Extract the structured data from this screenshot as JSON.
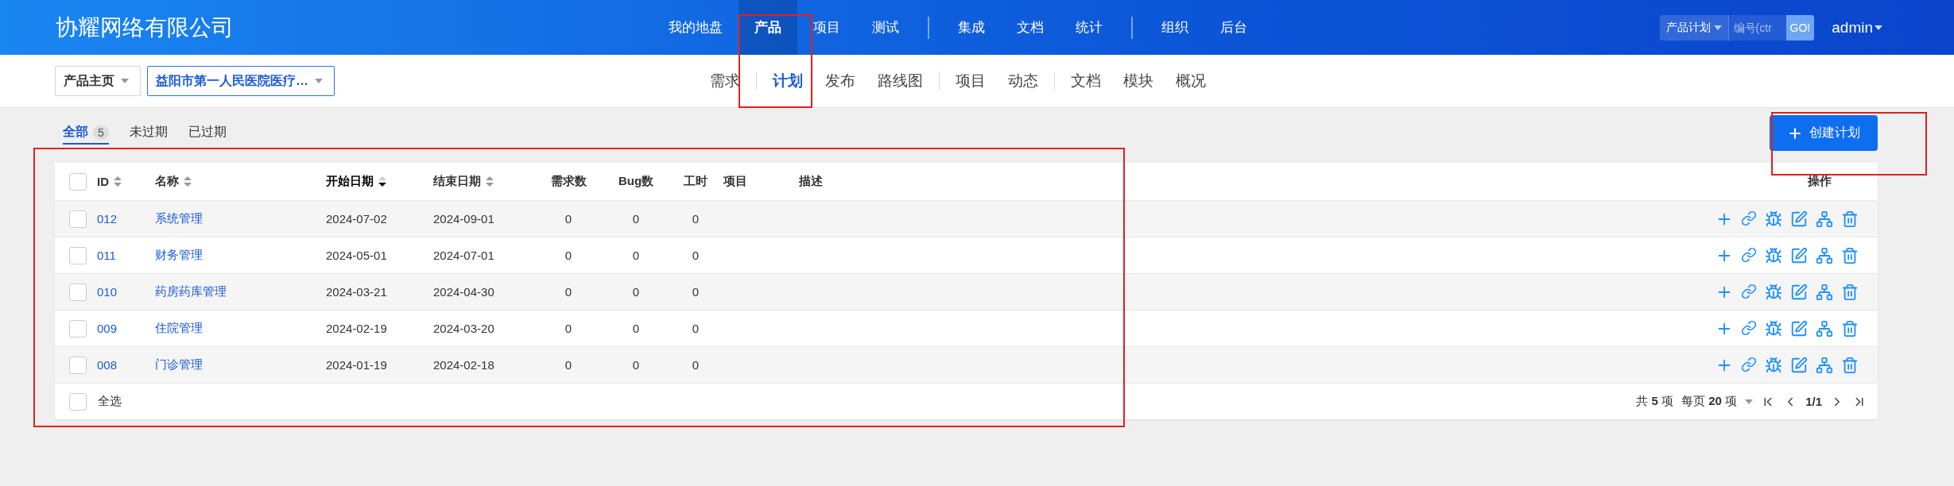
{
  "header": {
    "company": "协耀网络有限公司",
    "nav": [
      {
        "kind": "link",
        "label": "我的地盘",
        "selected": false
      },
      {
        "kind": "link",
        "label": "产品",
        "selected": true
      },
      {
        "kind": "link",
        "label": "项目",
        "selected": false
      },
      {
        "kind": "link",
        "label": "测试",
        "selected": false
      },
      {
        "kind": "divider"
      },
      {
        "kind": "link",
        "label": "集成",
        "selected": false
      },
      {
        "kind": "link",
        "label": "文档",
        "selected": false
      },
      {
        "kind": "link",
        "label": "统计",
        "selected": false
      },
      {
        "kind": "divider"
      },
      {
        "kind": "link",
        "label": "组织",
        "selected": false
      },
      {
        "kind": "link",
        "label": "后台",
        "selected": false
      }
    ],
    "search": {
      "scope": "产品计划",
      "placeholder": "编号(ctr",
      "button": "GO!"
    },
    "user": "admin"
  },
  "subbar": {
    "breadcrumbs": [
      {
        "label": "产品主页",
        "selected": false
      },
      {
        "label": "益阳市第一人民医院医疗…",
        "selected": true
      }
    ],
    "tabs": [
      {
        "kind": "link",
        "label": "需求",
        "selected": false
      },
      {
        "kind": "divider"
      },
      {
        "kind": "link",
        "label": "计划",
        "selected": true
      },
      {
        "kind": "link",
        "label": "发布",
        "selected": false
      },
      {
        "kind": "link",
        "label": "路线图",
        "selected": false
      },
      {
        "kind": "divider"
      },
      {
        "kind": "link",
        "label": "项目",
        "selected": false
      },
      {
        "kind": "link",
        "label": "动态",
        "selected": false
      },
      {
        "kind": "divider"
      },
      {
        "kind": "link",
        "label": "文档",
        "selected": false
      },
      {
        "kind": "link",
        "label": "模块",
        "selected": false
      },
      {
        "kind": "link",
        "label": "概况",
        "selected": false
      }
    ]
  },
  "filters": [
    {
      "label": "全部",
      "count": "5",
      "selected": true
    },
    {
      "label": "未过期",
      "selected": false
    },
    {
      "label": "已过期",
      "selected": false
    }
  ],
  "create_button": "创建计划",
  "table": {
    "select_all_checked": false,
    "columns": [
      {
        "label": "ID",
        "sortable": true,
        "sorted_desc": false
      },
      {
        "label": "名称",
        "sortable": true,
        "sorted_desc": false
      },
      {
        "label": "开始日期",
        "sortable": true,
        "sorted_desc": true
      },
      {
        "label": "结束日期",
        "sortable": true,
        "sorted_desc": false
      },
      {
        "label": "需求数"
      },
      {
        "label": "Bug数"
      },
      {
        "label": "工时"
      },
      {
        "label": "项目"
      },
      {
        "label": "描述"
      },
      {
        "label": "操作"
      }
    ],
    "rows": [
      {
        "id": "012",
        "name": "系统管理",
        "start": "2024-07-02",
        "end": "2024-09-01",
        "stories": "0",
        "bugs": "0",
        "hours": "0",
        "checked": false
      },
      {
        "id": "011",
        "name": "财务管理",
        "start": "2024-05-01",
        "end": "2024-07-01",
        "stories": "0",
        "bugs": "0",
        "hours": "0",
        "checked": false
      },
      {
        "id": "010",
        "name": "药房药库管理",
        "start": "2024-03-21",
        "end": "2024-04-30",
        "stories": "0",
        "bugs": "0",
        "hours": "0",
        "checked": false
      },
      {
        "id": "009",
        "name": "住院管理",
        "start": "2024-02-19",
        "end": "2024-03-20",
        "stories": "0",
        "bugs": "0",
        "hours": "0",
        "checked": false
      },
      {
        "id": "008",
        "name": "门诊管理",
        "start": "2024-01-19",
        "end": "2024-02-18",
        "stories": "0",
        "bugs": "0",
        "hours": "0",
        "checked": false
      }
    ],
    "footer": {
      "select_all": "全选",
      "checked": false,
      "total": "共 **5** 项",
      "per_page": "每页 **20** 项",
      "page": "1/1"
    }
  }
}
